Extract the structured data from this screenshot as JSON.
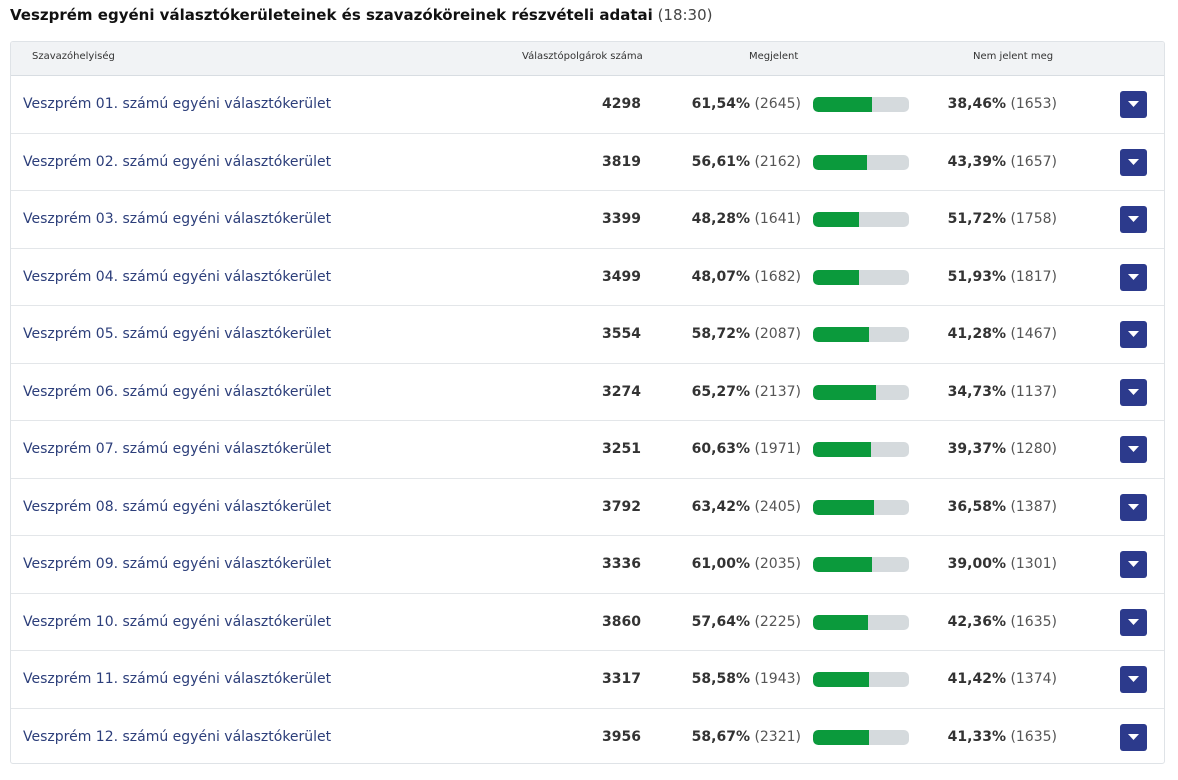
{
  "page": {
    "title": "Veszprém egyéni választókerületeinek és szavazóköreinek részvételi adatai",
    "time": "(18:30)"
  },
  "table": {
    "headers": {
      "place": "Szavazóhelyiség",
      "voters": "Választópolgárok száma",
      "appeared": "Megjelent",
      "absent": "Nem jelent meg"
    },
    "rows": [
      {
        "name": "Veszprém 01. számú egyéni választókerület",
        "voters": "4298",
        "appeared_pct": "61,54%",
        "appeared_count": "(2645)",
        "turnout": 0.6154,
        "absent_pct": "38,46%",
        "absent_count": "(1653)"
      },
      {
        "name": "Veszprém 02. számú egyéni választókerület",
        "voters": "3819",
        "appeared_pct": "56,61%",
        "appeared_count": "(2162)",
        "turnout": 0.5661,
        "absent_pct": "43,39%",
        "absent_count": "(1657)"
      },
      {
        "name": "Veszprém 03. számú egyéni választókerület",
        "voters": "3399",
        "appeared_pct": "48,28%",
        "appeared_count": "(1641)",
        "turnout": 0.4828,
        "absent_pct": "51,72%",
        "absent_count": "(1758)"
      },
      {
        "name": "Veszprém 04. számú egyéni választókerület",
        "voters": "3499",
        "appeared_pct": "48,07%",
        "appeared_count": "(1682)",
        "turnout": 0.4807,
        "absent_pct": "51,93%",
        "absent_count": "(1817)"
      },
      {
        "name": "Veszprém 05. számú egyéni választókerület",
        "voters": "3554",
        "appeared_pct": "58,72%",
        "appeared_count": "(2087)",
        "turnout": 0.5872,
        "absent_pct": "41,28%",
        "absent_count": "(1467)"
      },
      {
        "name": "Veszprém 06. számú egyéni választókerület",
        "voters": "3274",
        "appeared_pct": "65,27%",
        "appeared_count": "(2137)",
        "turnout": 0.6527,
        "absent_pct": "34,73%",
        "absent_count": "(1137)"
      },
      {
        "name": "Veszprém 07. számú egyéni választókerület",
        "voters": "3251",
        "appeared_pct": "60,63%",
        "appeared_count": "(1971)",
        "turnout": 0.6063,
        "absent_pct": "39,37%",
        "absent_count": "(1280)"
      },
      {
        "name": "Veszprém 08. számú egyéni választókerület",
        "voters": "3792",
        "appeared_pct": "63,42%",
        "appeared_count": "(2405)",
        "turnout": 0.6342,
        "absent_pct": "36,58%",
        "absent_count": "(1387)"
      },
      {
        "name": "Veszprém 09. számú egyéni választókerület",
        "voters": "3336",
        "appeared_pct": "61,00%",
        "appeared_count": "(2035)",
        "turnout": 0.61,
        "absent_pct": "39,00%",
        "absent_count": "(1301)"
      },
      {
        "name": "Veszprém 10. számú egyéni választókerület",
        "voters": "3860",
        "appeared_pct": "57,64%",
        "appeared_count": "(2225)",
        "turnout": 0.5764,
        "absent_pct": "42,36%",
        "absent_count": "(1635)"
      },
      {
        "name": "Veszprém 11. számú egyéni választókerület",
        "voters": "3317",
        "appeared_pct": "58,58%",
        "appeared_count": "(1943)",
        "turnout": 0.5858,
        "absent_pct": "41,42%",
        "absent_count": "(1374)"
      },
      {
        "name": "Veszprém 12. számú egyéni választókerület",
        "voters": "3956",
        "appeared_pct": "58,67%",
        "appeared_count": "(2321)",
        "turnout": 0.5867,
        "absent_pct": "41,33%",
        "absent_count": "(1635)"
      }
    ]
  },
  "icons": {
    "expand": "chevron-down-icon"
  },
  "colors": {
    "link": "#2c3e7a",
    "bar_fill": "#0b9a3c",
    "bar_track": "#d5dadd",
    "button": "#2c3a8c",
    "header_bg": "#f1f3f5"
  }
}
